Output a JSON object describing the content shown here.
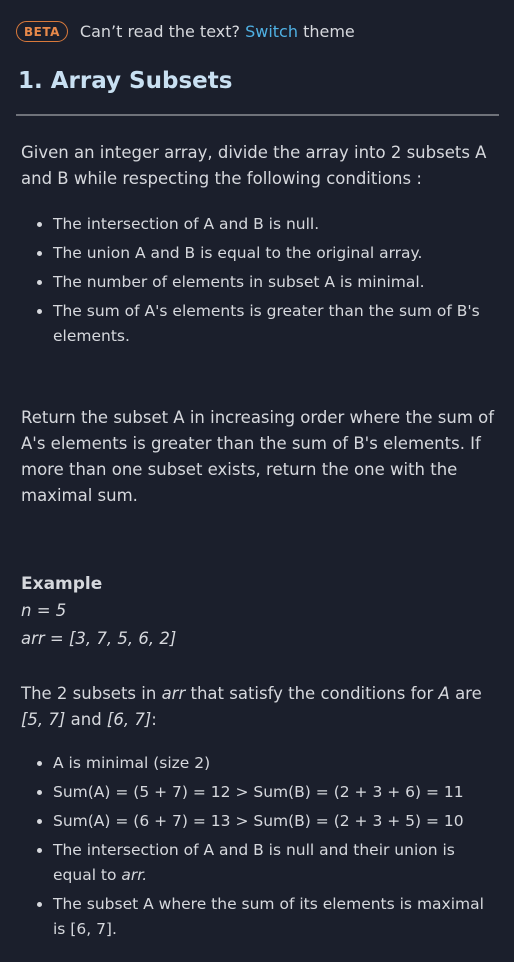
{
  "topbar": {
    "badge": "BETA",
    "notice_prefix": "Can’t read the text?",
    "notice_link": "Switch",
    "notice_suffix": "theme"
  },
  "problem": {
    "title": "1. Array Subsets",
    "intro": "Given an integer array, divide the array into 2 subsets A and B while respecting the following conditions :",
    "conditions": [
      "The intersection of A and B is null.",
      "The union A and B is equal to the original array.",
      "The number of elements in subset A is minimal.",
      "The sum of A's elements is greater than the sum of B's elements."
    ],
    "return_text": "Return the subset A in increasing order where the sum of A's elements is greater than the sum of B's elements. If more than one subset exists, return the one with the maximal sum."
  },
  "example": {
    "heading": "Example",
    "n_line": "n = 5",
    "arr_line": "arr = [3, 7, 5, 6, 2]",
    "subsets_line": {
      "pre": "The 2 subsets in ",
      "arr": "arr",
      "mid": " that satisfy the conditions for ",
      "a": "A",
      "post": " are",
      "s1": "[5, 7]",
      "and": " and ",
      "s2": "[6, 7]",
      "colon": ":"
    },
    "points": [
      "A is minimal (size 2)",
      "Sum(A) = (5 + 7) = 12 > Sum(B) = (2 + 3 + 6) = 11",
      "Sum(A) = (6 + 7) = 13 > Sum(B) = (2 + 3 + 5) = 10"
    ],
    "point4_pre": "The intersection of A and B is null and their union is equal to ",
    "point4_arr": "arr.",
    "point5": "The subset A where the sum of its elements is maximal is [6, 7]."
  },
  "colors": {
    "background": "#1b1f2c",
    "badge": "#e8894a",
    "link": "#4fb0e3",
    "title": "#c9e0f2"
  }
}
